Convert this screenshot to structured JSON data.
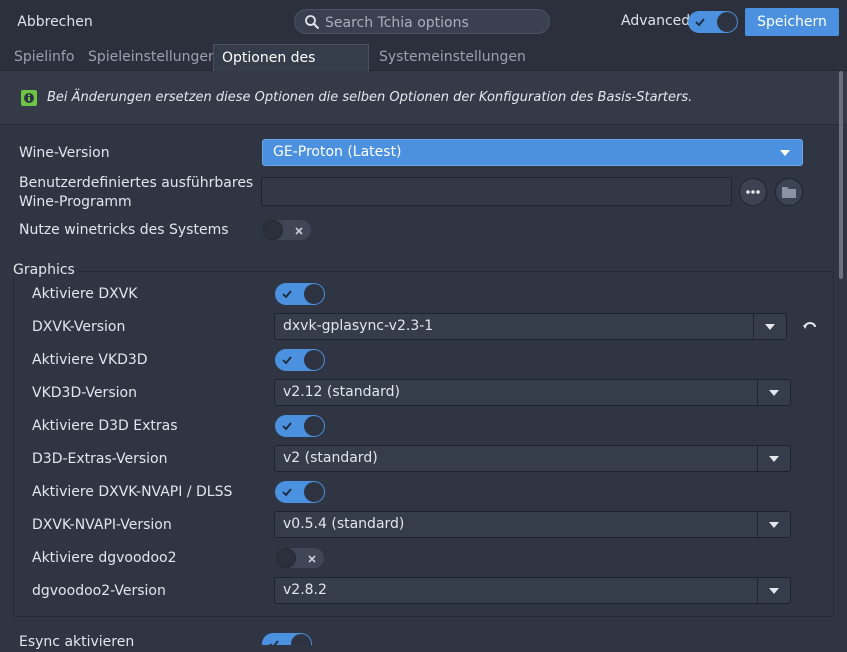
{
  "header": {
    "cancel_label": "Abbrechen",
    "search_placeholder": "Search Tchia options",
    "advanced_label": "Advanced",
    "advanced_on": true,
    "save_label": "Speichern"
  },
  "tabs": [
    {
      "label": "Spielinfo",
      "active": false
    },
    {
      "label": "Spieleinstellungen",
      "active": false
    },
    {
      "label": "Optionen des Starters",
      "active": true
    },
    {
      "label": "Systemeinstellungen",
      "active": false
    }
  ],
  "info": {
    "text": "Bei Änderungen ersetzen diese Optionen die selben Optionen der Konfiguration des Basis-Starters."
  },
  "wine": {
    "version_label": "Wine-Version",
    "version_value": "GE-Proton (Latest)",
    "custom_exe_label_1": "Benutzerdefiniertes ausführbares",
    "custom_exe_label_2": "Wine-Programm",
    "custom_exe_value": "",
    "winetricks_label": "Nutze winetricks des Systems",
    "winetricks_on": false
  },
  "graphics": {
    "title": "Graphics",
    "dxvk_label": "Aktiviere DXVK",
    "dxvk_on": true,
    "dxvk_version_label": "DXVK-Version",
    "dxvk_version_value": "dxvk-gplasync-v2.3-1",
    "vkd3d_label": "Aktiviere VKD3D",
    "vkd3d_on": true,
    "vkd3d_version_label": "VKD3D-Version",
    "vkd3d_version_value": "v2.12 (standard)",
    "d3d_extras_label": "Aktiviere D3D Extras",
    "d3d_extras_on": true,
    "d3d_extras_version_label": "D3D-Extras-Version",
    "d3d_extras_version_value": "v2 (standard)",
    "nvapi_label": "Aktiviere DXVK-NVAPI / DLSS",
    "nvapi_on": true,
    "nvapi_version_label": "DXVK-NVAPI-Version",
    "nvapi_version_value": "v0.5.4 (standard)",
    "dgvoodoo_label": "Aktiviere dgvoodoo2",
    "dgvoodoo_on": false,
    "dgvoodoo_version_label": "dgvoodoo2-Version",
    "dgvoodoo_version_value": "v2.8.2"
  },
  "esync": {
    "label": "Esync aktivieren",
    "on": true
  },
  "colors": {
    "accent": "#4b91e0",
    "background": "#2f3543",
    "header": "#2b303c"
  }
}
